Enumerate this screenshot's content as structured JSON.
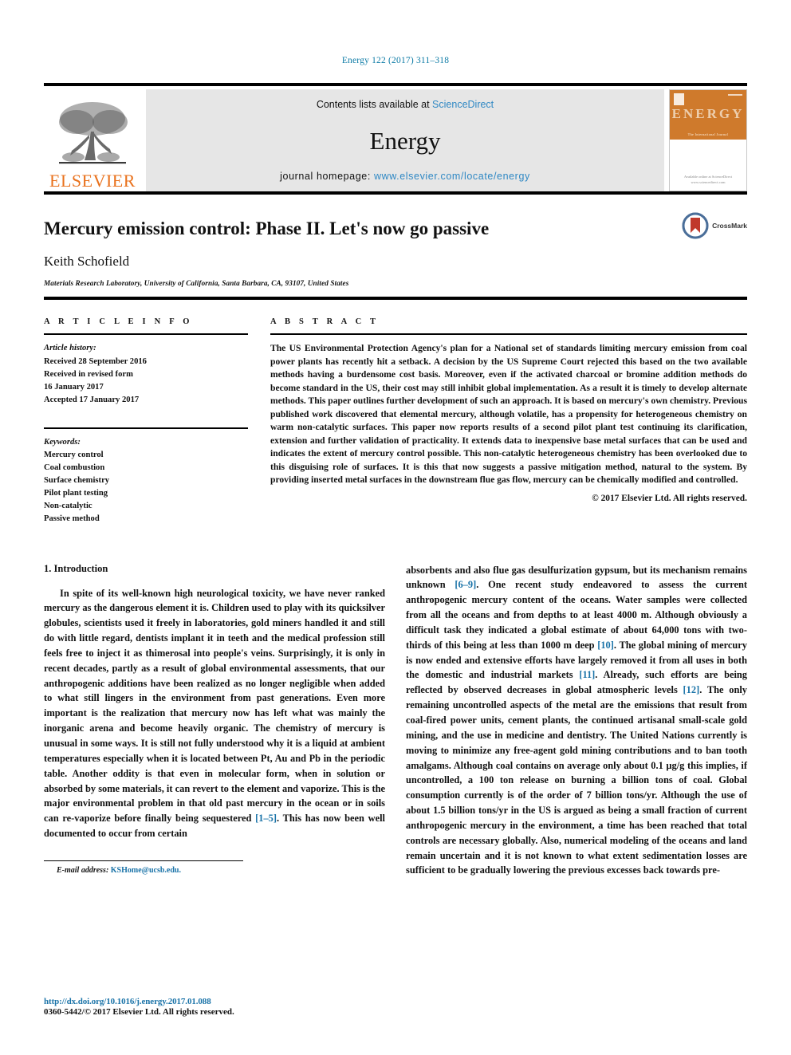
{
  "running_head": "Energy 122 (2017) 311–318",
  "masthead": {
    "contents_prefix": "Contents lists available at ",
    "contents_link": "ScienceDirect",
    "journal_title": "Energy",
    "homepage_prefix": "journal homepage: ",
    "homepage_url": "www.elsevier.com/locate/energy",
    "publisher": "ELSEVIER",
    "cover_word": "ENERGY",
    "cover_sub": "The International Journal",
    "cover_pub": "Available online at\nScienceDirect\nwww.sciencedirect.com"
  },
  "title_block": {
    "title": "Mercury emission control: Phase II. Let's now go passive",
    "author": "Keith Schofield",
    "affiliation": "Materials Research Laboratory, University of California, Santa Barbara, CA, 93107, United States",
    "crossmark_label": "CrossMark"
  },
  "article_info": {
    "label": "A R T I C L E   I N F O",
    "history_heading": "Article history:",
    "history": [
      "Received 28 September 2016",
      "Received in revised form",
      "16 January 2017",
      "Accepted 17 January 2017"
    ],
    "keywords_heading": "Keywords:",
    "keywords": [
      "Mercury control",
      "Coal combustion",
      "Surface chemistry",
      "Pilot plant testing",
      "Non-catalytic",
      "Passive method"
    ]
  },
  "abstract": {
    "label": "A B S T R A C T",
    "text": "The US Environmental Protection Agency's plan for a National set of standards limiting mercury emission from coal power plants has recently hit a setback. A decision by the US Supreme Court rejected this based on the two available methods having a burdensome cost basis. Moreover, even if the activated charcoal or bromine addition methods do become standard in the US, their cost may still inhibit global implementation. As a result it is timely to develop alternate methods. This paper outlines further development of such an approach. It is based on mercury's own chemistry. Previous published work discovered that elemental mercury, although volatile, has a propensity for heterogeneous chemistry on warm non-catalytic surfaces. This paper now reports results of a second pilot plant test continuing its clarification, extension and further validation of practicality. It extends data to inexpensive base metal surfaces that can be used and indicates the extent of mercury control possible. This non-catalytic heterogeneous chemistry has been overlooked due to this disguising role of surfaces. It is this that now suggests a passive mitigation method, natural to the system. By providing inserted metal surfaces in the downstream flue gas flow, mercury can be chemically modified and controlled.",
    "copyright": "© 2017 Elsevier Ltd. All rights reserved."
  },
  "body": {
    "section_number_title": "1. Introduction",
    "left_paragraph_1": "In spite of its well-known high neurological toxicity, we have never ranked mercury as the dangerous element it is. Children used to play with its quicksilver globules, scientists used it freely in laboratories, gold miners handled it and still do with little regard, dentists implant it in teeth and the medical profession still feels free to inject it as thimerosal into people's veins. Surprisingly, it is only in recent decades, partly as a result of global environmental assessments, that our anthropogenic additions have been realized as no longer negligible when added to what still lingers in the environment from past generations. Even more important is the realization that mercury now has left what was mainly the inorganic arena and become heavily organic. The chemistry of mercury is unusual in some ways. It is still not fully understood why it is a liquid at ambient temperatures especially when it is located between Pt, Au and Pb in the periodic table. Another oddity is that even in molecular form, when in solution or absorbed by some materials, it can revert to the element and vaporize. This is the major environmental problem in that old past mercury in the ocean or in soils can re-vaporize before finally being sequestered ",
    "left_ref_1": "[1–5]",
    "left_paragraph_1_tail": ". This has now been well documented to occur from certain",
    "right_paragraph_head": "absorbents and also flue gas desulfurization gypsum, but its mechanism remains unknown ",
    "right_ref_1": "[6–9]",
    "right_seg_1": ". One recent study endeavored to assess the current anthropogenic mercury content of the oceans. Water samples were collected from all the oceans and from depths to at least 4000 m. Although obviously a difficult task they indicated a global estimate of about 64,000 tons with two-thirds of this being at less than 1000 m deep ",
    "right_ref_2": "[10]",
    "right_seg_2": ". The global mining of mercury is now ended and extensive efforts have largely removed it from all uses in both the domestic and industrial markets ",
    "right_ref_3": "[11]",
    "right_seg_3": ". Already, such efforts are being reflected by observed decreases in global atmospheric levels ",
    "right_ref_4": "[12]",
    "right_seg_4": ". The only remaining uncontrolled aspects of the metal are the emissions that result from coal-fired power units, cement plants, the continued artisanal small-scale gold mining, and the use in medicine and dentistry. The United Nations currently is moving to minimize any free-agent gold mining contributions and to ban tooth amalgams. Although coal contains on average only about 0.1 µg/g this implies, if uncontrolled, a 100 ton release on burning a billion tons of coal. Global consumption currently is of the order of 7 billion tons/yr. Although the use of about 1.5 billion tons/yr in the US is argued as being a small fraction of current anthropogenic mercury in the environment, a time has been reached that total controls are necessary globally. Also, numerical modeling of the oceans and land remain uncertain and it is not known to what extent sedimentation losses are sufficient to be gradually lowering the previous excesses back towards pre-"
  },
  "footnote": {
    "label": "E-mail address:",
    "email": "KSHome@ucsb.edu."
  },
  "footer": {
    "doi": "http://dx.doi.org/10.1016/j.energy.2017.01.088",
    "issn": "0360-5442/© 2017 Elsevier Ltd. All rights reserved."
  },
  "colors": {
    "link": "#1a73a8",
    "elsevier_orange": "#E9711C",
    "cover_orange": "#cf7a2c",
    "masthead_bg": "#e6e6e6"
  }
}
